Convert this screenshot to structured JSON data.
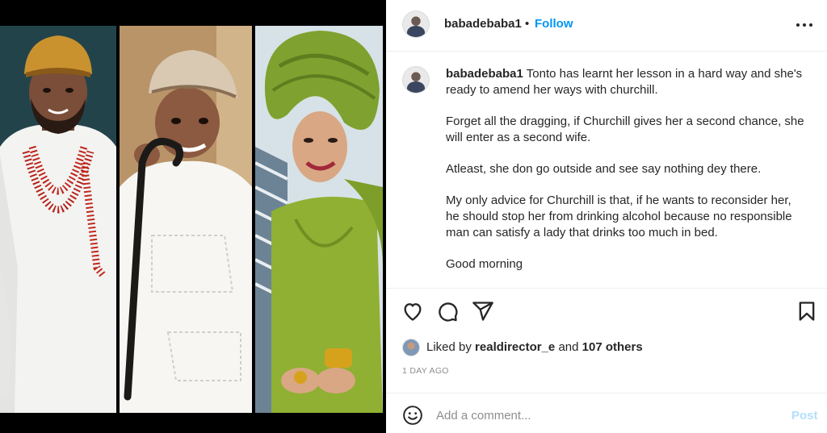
{
  "post": {
    "author": "babadebaba1",
    "separator": "•",
    "follow_label": "Follow",
    "more_icon": "more-options-icon",
    "caption": {
      "username": "babadebaba1",
      "paragraphs": [
        "Tonto has learnt her lesson in a hard way and she's ready to amend her ways with churchill.",
        "Forget all the dragging, if Churchill gives her a second chance, she will enter as a second wife.",
        "Atleast, she don go outside and see say nothing dey there.",
        "My only advice for Churchill is that, if he wants to reconsider her, he should stop her from drinking alcohol because no responsible man can satisfy a lady that drinks too much in bed.",
        "Good morning"
      ]
    },
    "actions": {
      "like_icon": "heart-icon",
      "comment_icon": "comment-icon",
      "share_icon": "share-icon",
      "save_icon": "bookmark-icon"
    },
    "likes": {
      "prefix": "Liked by",
      "user": "realdirector_e",
      "connector": "and",
      "others": "107 others"
    },
    "timestamp": "1 DAY AGO",
    "comment": {
      "placeholder": "Add a comment...",
      "post_label": "Post",
      "emoji_icon": "emoji-icon"
    },
    "colors": {
      "link_blue": "#0095f6",
      "post_disabled": "#b2dffc",
      "muted": "#8e8e8e",
      "text": "#262626"
    }
  },
  "media": {
    "panels": [
      "man-in-white-attire",
      "boy-with-walking-stick",
      "woman-in-green-gele"
    ]
  }
}
